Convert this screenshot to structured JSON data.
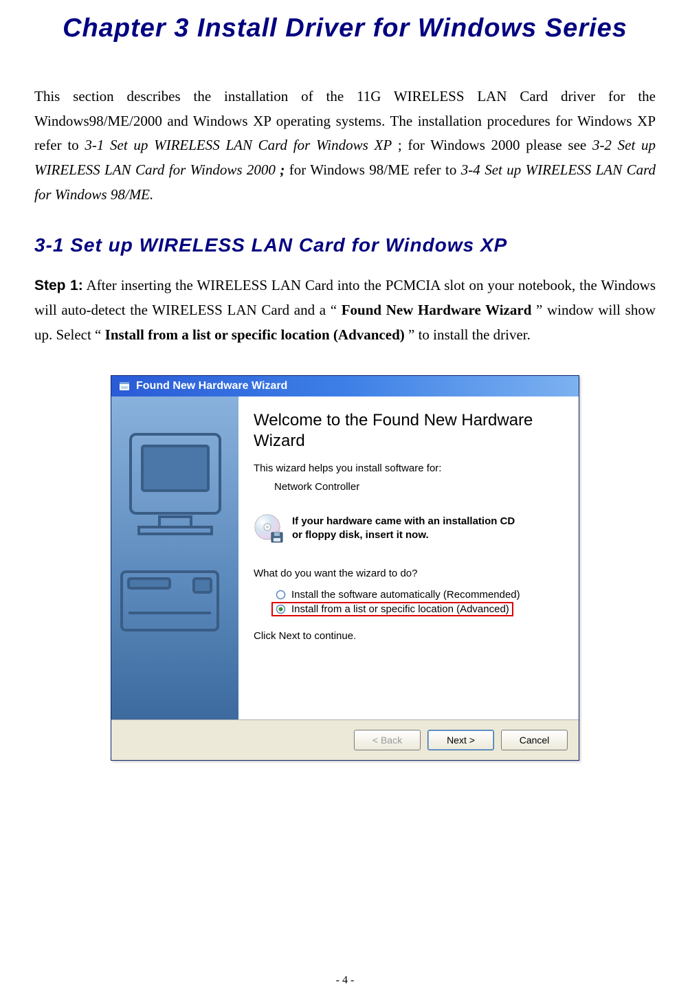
{
  "chapter_title": "Chapter 3 Install Driver for Windows Series",
  "intro": {
    "p1_pre": "This section describes the installation of the 11G WIRELESS LAN Card driver for the Windows98/ME/2000 and Windows XP operating systems. The installation procedures for Windows XP refer to ",
    "p1_i1": "3-1 Set up WIRELESS LAN Card for Windows XP",
    "p1_mid1": "; for Windows 2000 please see ",
    "p1_i2": "3-2 Set up WIRELESS LAN Card for Windows 2000",
    "p1_semibold": ";",
    "p1_mid2": " for Windows 98/ME refer to ",
    "p1_i3": "3-4 Set up WIRELESS LAN Card for Windows 98/ME."
  },
  "section_title": "3-1 Set up WIRELESS LAN Card for Windows XP",
  "step1": {
    "label": "Step 1:",
    "t1": " After inserting the WIRELESS LAN Card into the PCMCIA slot on your notebook, the Windows will auto-detect the WIRELESS LAN Card and a “",
    "b1": "Found New Hardware Wizard",
    "t2": "” window will show up. Select “",
    "b2": "Install from a list or specific location (Advanced)",
    "t3": "” to install the driver."
  },
  "wizard": {
    "titlebar": "Found New Hardware Wizard",
    "welcome": "Welcome to the Found New Hardware Wizard",
    "helps": "This wizard helps you install software for:",
    "device": "Network Controller",
    "cd_line1": "If your hardware came with an installation CD",
    "cd_line2": "or floppy disk, insert it now.",
    "question": "What do you want the wizard to do?",
    "opt_auto": "Install the software automatically (Recommended)",
    "opt_list": "Install from a list or specific location (Advanced)",
    "continue": "Click Next to continue.",
    "btn_back": "< Back",
    "btn_next": "Next >",
    "btn_cancel": "Cancel"
  },
  "page_number": "- 4 -"
}
